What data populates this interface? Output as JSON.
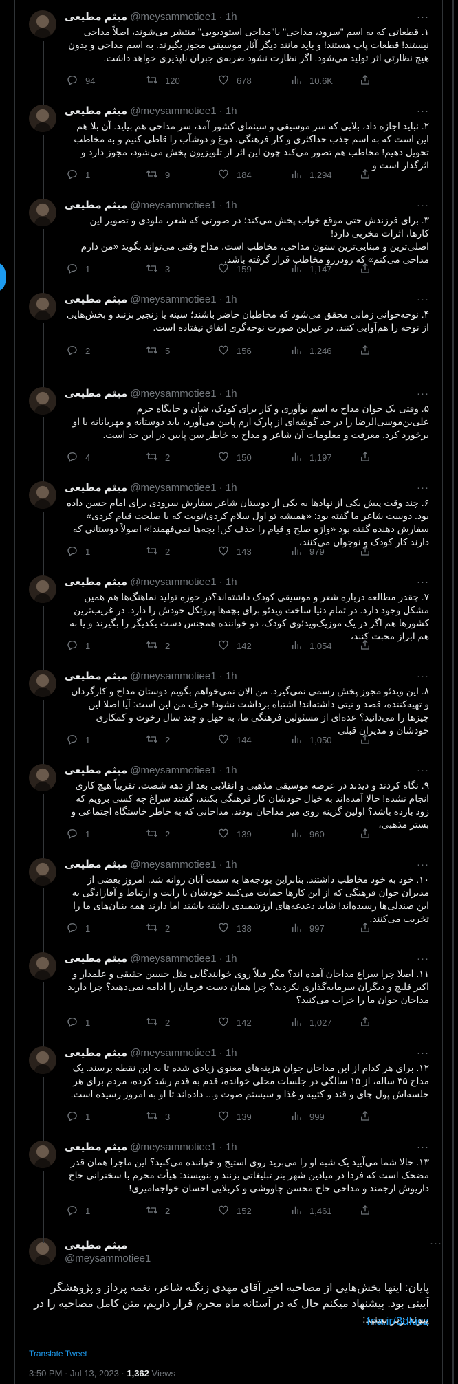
{
  "author": {
    "name": "میثم مطیعی",
    "handle": "@meysammotiee1",
    "time": "1h"
  },
  "tweets": [
    {
      "text": "۱. قطعاتی که به اسم \"سرود، مداحی\" یا\"مداحی استودیویی\" منتشر می‌شوند، اصلاً مداحی نیستند! قطعات پاپ هستند! و باید مانند دیگر آثار موسیقی مجوز بگیرند. به اسم مداحی و بدون هیچ نظارتی اثر تولید می‌شود. اگر نظارت نشود ضربه‌ی جبران ناپذیری خواهد داشت.",
      "replies": "94",
      "retweets": "120",
      "likes": "678",
      "views": "10.6K"
    },
    {
      "text": "۲. نباید اجازه داد، بلایی که سر موسیقی و سینمای کشور آمد، سر مداحی هم بیاید. آن بلا هم این است که به اسم جذب حداکثری و کار فرهنگی، دوغ و دوشآب را قاطی کنیم و به مخاطب تحویل دهیم! مخاطب هم تصور می‌کند چون این اثر از تلویزیون پخش می‌شود، مجوز دارد و اثرگذار است و",
      "replies": "1",
      "retweets": "9",
      "likes": "184",
      "views": "1,294"
    },
    {
      "text": "۳. برای فرزندش حتی موقع خواب پخش می‌کند؛ در صورتی که شعر، ملودی و تصویر این کارها، اثرات مخربی دارد!\nاصلی‌ترین و مبنایی‌ترین ستون مداحی، مخاطب است. مداح وقتی می‌تواند بگوید «من دارم مداحی می‌کنم» که رودررو مخاطب قرار گرفته باشد.",
      "replies": "1",
      "retweets": "3",
      "likes": "159",
      "views": "1,147"
    },
    {
      "text": "۴. نوحه‌خوانی زمانی محقق می‌شود که مخاطبان حاضر باشند؛ سینه یا زنجیر بزنند و بخش‌هایی از نوحه را هم‌آوایی کنند. در غیراین صورت نوحه‌گری اتفاق نیفتاده است.",
      "replies": "2",
      "retweets": "5",
      "likes": "156",
      "views": "1,246"
    },
    {
      "text": "۵. وقتی یک جوان مداح به اسم نوآوری و کار برای کودک، شأن و جایگاه حرم علی‌بن‌موسی‌الرضا را در حد گوشه‌ای از پارک ارم پایین می‌آورد، باید دوستانه و مهربانانه با او برخورد کرد. معرفت و معلومات آن شاعر و مداح به خاطر سن پایین در این حد است.",
      "replies": "4",
      "retweets": "2",
      "likes": "150",
      "views": "1,197"
    },
    {
      "text": "۶. چند وقت پیش یکی از نهادها به یکی از دوستان شاعر سفارش سرودی برای امام حسن داده بود. دوست شاعر ما گفته بود: «همیشه تو اول سلام کردی/نوبت که با صلحت قیام کردی» سفارش دهنده گفته بود «واژه صلح و قیام را حذف کن! بچه‌ها نمی‌فهمند!» اصولاً دوستانی که دارند کار کودک و نوجوان می‌کنند،",
      "replies": "1",
      "retweets": "2",
      "likes": "143",
      "views": "979"
    },
    {
      "text": "۷. چقدر مطالعه درباره شعر و موسیقی کودک داشته‌اند؟در حوزه تولید نماهنگ‌ها هم همین مشکل وجود دارد. در تمام دنیا ساخت ویدئو برای بچه‌ها پروتکل خودش را دارد. در غریب‌ترین کشورها هم اگر در یک موزیک‌ویدئوی کودک، دو خواننده همجنس دست یکدیگر را بگیرند و یا به هم ابراز محبت کنند،",
      "replies": "1",
      "retweets": "2",
      "likes": "142",
      "views": "1,054"
    },
    {
      "text": "۸. این ویدئو مجوز پخش رسمی نمی‌گیرد. من الان نمی‌خواهم بگویم دوستان مداح و کارگردان و تهیه‌کننده، قصد و نیتی داشته‌اند! اشتباه برداشت نشود! حرف من این است: آیا اصلا این چیزها را می‌دانید؟ عده‌ای از مسئولین فرهنگی ما، به جهل و چند سال رخوت و کمکاری خودشان و مدیران قبلی",
      "replies": "1",
      "retweets": "2",
      "likes": "144",
      "views": "1,050"
    },
    {
      "text": "۹. نگاه کردند و دیدند در عرصه موسیقی مذهبی و انقلابی بعد از دهه شصت، تقریباً هیچ کاری انجام نشده! حالا آمده‌اند به خیال خودشان کار فرهنگی بکنند، گفتند سراغ چه کسی برویم که زود بازده باشد؟ اولین گزینه روی میز مداحان بودند. مداحانی که به خاطر خاستگاه اجتماعی و بستر مذهبی،",
      "replies": "1",
      "retweets": "2",
      "likes": "139",
      "views": "960"
    },
    {
      "text": "۱۰. خود به خود مخاطب داشتند. بنابراین بودجه‌ها به سمت آنان روانه شد. امروز بعضی از مدیران جوان فرهنگی که از این کارها حمایت می‌کنند خودشان با رانت و ارتباط و آقازادگی به این صندلی‌ها رسیده‌اند! شاید دغدغه‌های ارزشمندی داشته باشند اما دارند همه بنیان‌های ما را تخریب می‌کنند.",
      "replies": "1",
      "retweets": "2",
      "likes": "138",
      "views": "997"
    },
    {
      "text": "۱۱. اصلا چرا سراغ مداحان آمده اند؟ مگر قبلاً روی خوانندگانی مثل حسین حقیقی و علمدار و اکبر قلیچ و دیگران سرمایه‌گذاری نکردید؟ چرا همان دست فرمان را ادامه نمی‌دهید؟ چرا دارید مداحان جوان ما را خراب می‌کنید؟",
      "replies": "1",
      "retweets": "2",
      "likes": "142",
      "views": "1,027"
    },
    {
      "text": "۱۲. برای هر کدام از این مداحان جوان هزینه‌های معنوی زیادی شده تا به این نقطه برسند. یک مداح ۳۵ ساله، از ۱۵ سالگی در جلسات محلی خوانده، قدم به قدم رشد کرده، مردم برای هر جلسه‌اش پول چای و قند و کتیبه و غذا و سیستم صوت و... داده‌اند تا او به امروز رسیده است.",
      "replies": "1",
      "retweets": "3",
      "likes": "139",
      "views": "999"
    },
    {
      "text": "۱۳. حالا شما می‌آیید یک شبه او را می‌برید روی استیج و خواننده می‌کنید؟ این ماجرا همان قدر مضحک است که فردا در میادین شهر بنر تبلیغاتی بزنند و بنویسند: هیأت محرم با سخنرانی حاج داریوش ارجمند و مداحی حاج محسن چاووشی و کربلایی احسان خواجه‌امیری!",
      "replies": "1",
      "retweets": "2",
      "likes": "152",
      "views": "1,461"
    }
  ],
  "final": {
    "name": "میثم مطیعی",
    "handle": "@meysammotiee1",
    "text": "پایان: اینها بخش‌هایی از مصاحبه اخیر آقای مهدی زنگنه شاعر، نغمه پرداز و پژوهشگر آیینی بود. پیشنهاد میکنم حال که در آستانه ماه محرم قرار داریم، متن کامل مصاحبه را در پیوند زیر ببینید:",
    "link": "fna.ir/3dkicz",
    "translate": "Translate Tweet",
    "timestamp": "3:50 PM · Jul 13, 2023 · ",
    "views_count": "1,362",
    "views_label": " Views"
  },
  "more_label": "···",
  "colors": {
    "background": "#000000",
    "text": "#e7e9ea",
    "muted": "#71767b",
    "accent": "#1d9bf0"
  },
  "icons": [
    "reply-icon",
    "retweet-icon",
    "like-icon",
    "views-icon",
    "share-icon",
    "more-icon"
  ]
}
